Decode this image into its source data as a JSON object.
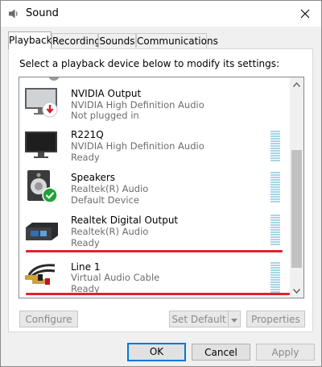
{
  "window": {
    "title": "Sound",
    "icon": "speaker-icon"
  },
  "tabs": [
    {
      "label": "Playback",
      "active": true
    },
    {
      "label": "Recording",
      "active": false
    },
    {
      "label": "Sounds",
      "active": false
    },
    {
      "label": "Communications",
      "active": false
    }
  ],
  "panel": {
    "instruction": "Select a playback device below to modify its settings:",
    "devices": [
      {
        "name": "NVIDIA Output",
        "driver": "NVIDIA High Definition Audio",
        "status": "Not plugged in",
        "icon": "monitor-icon",
        "badge": "red-down-arrow"
      },
      {
        "name": "R221Q",
        "driver": "NVIDIA High Definition Audio",
        "status": "Ready",
        "icon": "monitor-icon"
      },
      {
        "name": "Speakers",
        "driver": "Realtek(R) Audio",
        "status": "Default Device",
        "icon": "speaker-icon",
        "badge": "green-check"
      },
      {
        "name": "Realtek Digital Output",
        "driver": "Realtek(R) Audio",
        "status": "Ready",
        "icon": "digital-output-icon"
      },
      {
        "name": "Line 1",
        "driver": "Virtual Audio Cable",
        "status": "Ready",
        "icon": "rca-cable-icon"
      }
    ]
  },
  "buttons": {
    "configure": "Configure",
    "set_default": "Set Default",
    "properties": "Properties",
    "ok": "OK",
    "cancel": "Cancel",
    "apply": "Apply"
  },
  "colors": {
    "highlight_line": "#e0222d",
    "default_button_border": "#0078d7",
    "level_meter": "#a8d6e8"
  }
}
